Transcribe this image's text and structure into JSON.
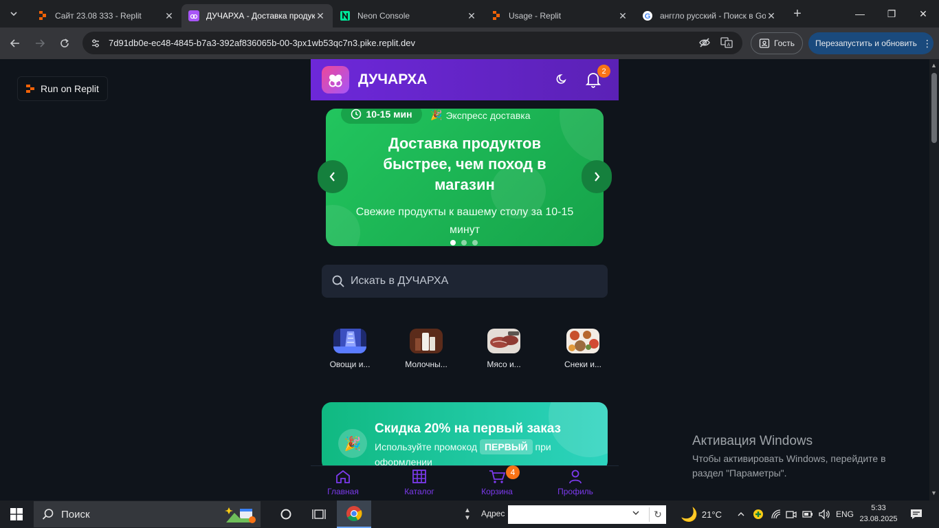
{
  "browser": {
    "tabs": [
      {
        "title": "Сайт 23.08 333 - Replit",
        "active": false
      },
      {
        "title": "ДУЧАРХА - Доставка продуктов",
        "active": true
      },
      {
        "title": "Neon Console",
        "active": false
      },
      {
        "title": "Usage - Replit",
        "active": false
      },
      {
        "title": "анггло русский - Поиск в Google",
        "active": false
      }
    ],
    "url": "7d91db0e-ec48-4845-b7a3-392af836065b-00-3px1wb53qc7n3.pike.replit.dev",
    "guest_label": "Гость",
    "restart_label": "Перезапустить и обновить"
  },
  "replit_badge": "Run on Replit",
  "app": {
    "brand": "ДУЧАРХА",
    "notification_count": "2",
    "banner": {
      "time_pill": "10-15 мин",
      "express": "Экспресс доставка",
      "title": "Доставка продуктов быстрее, чем поход в магазин",
      "subtitle": "Свежие продукты к вашему столу за 10-15 минут",
      "active_slide": 1,
      "slide_count": 3
    },
    "search_placeholder": "Искать в ДУЧАРХА",
    "categories": [
      {
        "label": "Овощи и..."
      },
      {
        "label": "Молочны..."
      },
      {
        "label": "Мясо и..."
      },
      {
        "label": "Снеки и..."
      }
    ],
    "promo": {
      "title": "Скидка 20% на первый заказ",
      "text_before": "Используйте промокод",
      "code": "ПЕРВЫЙ",
      "text_after": "при оформлении"
    },
    "bottom_nav": {
      "home": "Главная",
      "catalog": "Каталог",
      "cart": "Корзина",
      "profile": "Профиль",
      "cart_count": "4"
    }
  },
  "windows": {
    "activation_title": "Активация Windows",
    "activation_text": "Чтобы активировать Windows, перейдите в раздел \"Параметры\".",
    "search_label": "Поиск",
    "address_label": "Адрес",
    "weather": "21°C",
    "language": "ENG",
    "time": "5:33",
    "date": "23.08.2025"
  },
  "colors": {
    "header": "#6d28d9",
    "banner": "#22c55e",
    "promo": "#10b981",
    "badge": "#f97316",
    "nav_accent": "#7c3aed"
  }
}
